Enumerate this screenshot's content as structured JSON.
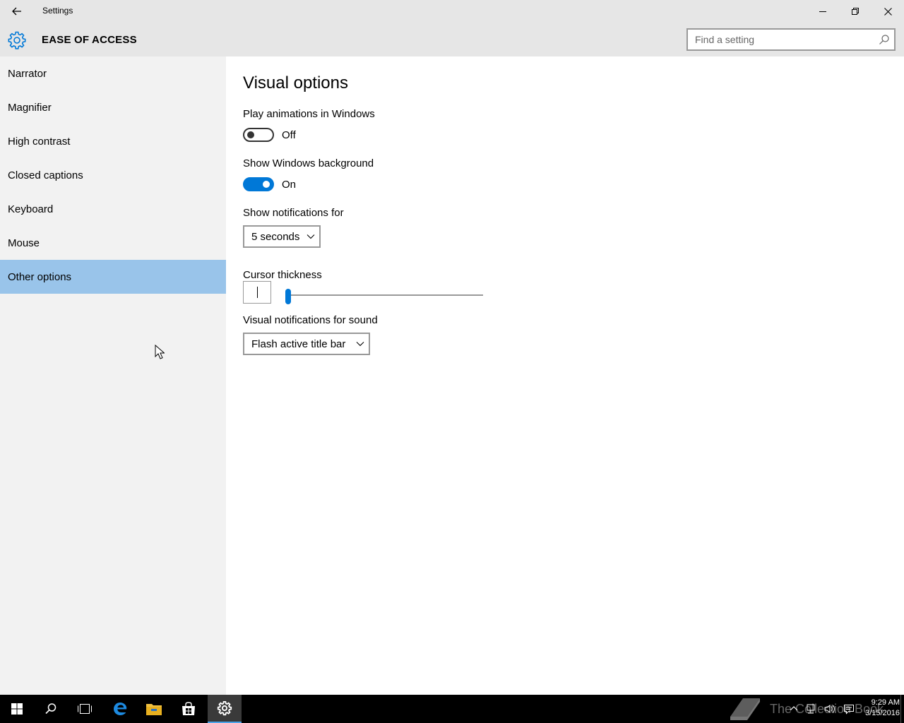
{
  "window": {
    "title": "Settings"
  },
  "header": {
    "section_title": "EASE OF ACCESS",
    "search_placeholder": "Find a setting"
  },
  "sidebar": {
    "items": [
      {
        "label": "Narrator",
        "selected": false
      },
      {
        "label": "Magnifier",
        "selected": false
      },
      {
        "label": "High contrast",
        "selected": false
      },
      {
        "label": "Closed captions",
        "selected": false
      },
      {
        "label": "Keyboard",
        "selected": false
      },
      {
        "label": "Mouse",
        "selected": false
      },
      {
        "label": "Other options",
        "selected": true
      }
    ]
  },
  "main": {
    "title": "Visual options",
    "play_animations": {
      "label": "Play animations in Windows",
      "state": "Off",
      "on": false
    },
    "show_background": {
      "label": "Show Windows background",
      "state": "On",
      "on": true
    },
    "notifications": {
      "label": "Show notifications for",
      "selected": "5 seconds"
    },
    "cursor_thickness": {
      "label": "Cursor thickness",
      "value_fraction": 0.0
    },
    "visual_sound": {
      "label": "Visual notifications for sound",
      "selected": "Flash active title bar"
    }
  },
  "taskbar": {
    "icons": [
      "start-icon",
      "search-icon",
      "task-view-icon",
      "edge-icon",
      "file-explorer-icon",
      "store-icon",
      "settings-icon"
    ],
    "active_app": "settings-icon",
    "watermark": "The Collection Book",
    "time": "9:29 AM",
    "date": "3/15/2016"
  },
  "colors": {
    "accent": "#0078d7",
    "selected_nav": "#99c4ea",
    "titlebar": "#e6e6e6",
    "sidebar": "#f2f2f2"
  }
}
